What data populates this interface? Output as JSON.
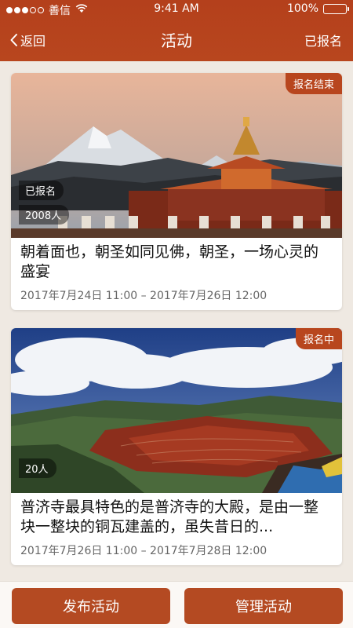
{
  "status_bar": {
    "carrier": "善信",
    "time": "9:41 AM",
    "battery": "100%",
    "signal_icon": "signal-dots-icon",
    "wifi_icon": "wifi-icon",
    "battery_icon": "battery-icon"
  },
  "nav": {
    "back_label": "返回",
    "title": "活动",
    "action_label": "已报名"
  },
  "activities": [
    {
      "status": "报名结束",
      "registered_badge": "已报名",
      "count": "2008人",
      "title": "朝着面也，朝圣如同见佛，朝圣，一场心灵的盛宴",
      "time": "2017年7月24日 11:00 – 2017年7月26日 12:00"
    },
    {
      "status": "报名中",
      "count": "20人",
      "title": "普济寺最具特色的是普济寺的大殿，是由一整块一整块的铜瓦建盖的，虽失昔日的...",
      "time": "2017年7月26日 11:00 – 2017年7月28日 12:00"
    }
  ],
  "footer": {
    "publish_label": "发布活动",
    "manage_label": "管理活动"
  },
  "colors": {
    "brand": "#b8461e",
    "button": "#b44a22",
    "background": "#efe9e2"
  }
}
